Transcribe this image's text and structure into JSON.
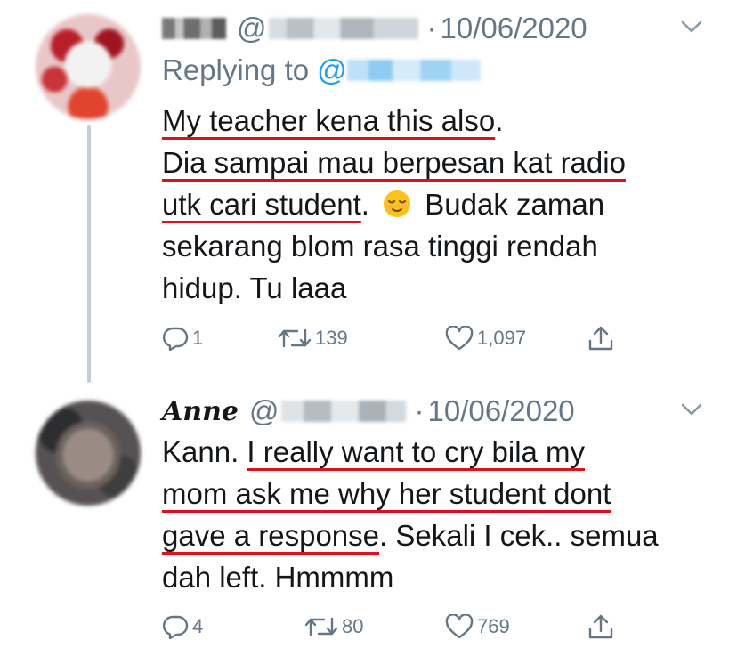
{
  "tweets": [
    {
      "display_name": "",
      "at": "@",
      "separator": "·",
      "date": "10/06/2020",
      "replying_to_label": "Replying to",
      "replying_to_at": "@",
      "lines": [
        {
          "segments": [
            {
              "text": "My teacher kena this also",
              "underline": true
            },
            {
              "text": ".",
              "underline": false
            }
          ]
        },
        {
          "segments": [
            {
              "text": "Dia sampai mau berpesan kat radio",
              "underline": true
            }
          ]
        },
        {
          "segments": [
            {
              "text": "utk cari student",
              "underline": true
            },
            {
              "text": ". ",
              "underline": false
            },
            {
              "emoji": "relieved-face"
            },
            {
              "text": " Budak zaman",
              "underline": false
            }
          ]
        },
        {
          "segments": [
            {
              "text": "sekarang blom rasa tinggi rendah",
              "underline": false
            }
          ]
        },
        {
          "segments": [
            {
              "text": "hidup. Tu laaa",
              "underline": false
            }
          ]
        }
      ],
      "actions": {
        "reply_count": "1",
        "retweet_count": "139",
        "like_count": "1,097"
      }
    },
    {
      "display_name": "Anne",
      "at": "@",
      "separator": "·",
      "date": "10/06/2020",
      "lines": [
        {
          "segments": [
            {
              "text": "Kann. ",
              "underline": false
            },
            {
              "text": "I really want to cry bila my",
              "underline": true
            }
          ]
        },
        {
          "segments": [
            {
              "text": "mom ask me why her student dont",
              "underline": true
            }
          ]
        },
        {
          "segments": [
            {
              "text": "gave a response",
              "underline": true
            },
            {
              "text": ". Sekali I cek.. semua",
              "underline": false
            }
          ]
        },
        {
          "segments": [
            {
              "text": "dah left. Hmmmm",
              "underline": false
            }
          ]
        }
      ],
      "actions": {
        "reply_count": "4",
        "retweet_count": "80",
        "like_count": "769"
      }
    }
  ],
  "icons": {
    "more": "chevron-down-icon",
    "reply": "reply-icon",
    "retweet": "retweet-icon",
    "like": "heart-icon",
    "share": "share-icon",
    "emoji": "relieved-face-emoji"
  },
  "colors": {
    "text": "#14171a",
    "secondary": "#657786",
    "link": "#1da1f2",
    "underline_markup": "#e0101a",
    "thread_line": "#c4cfd6"
  }
}
